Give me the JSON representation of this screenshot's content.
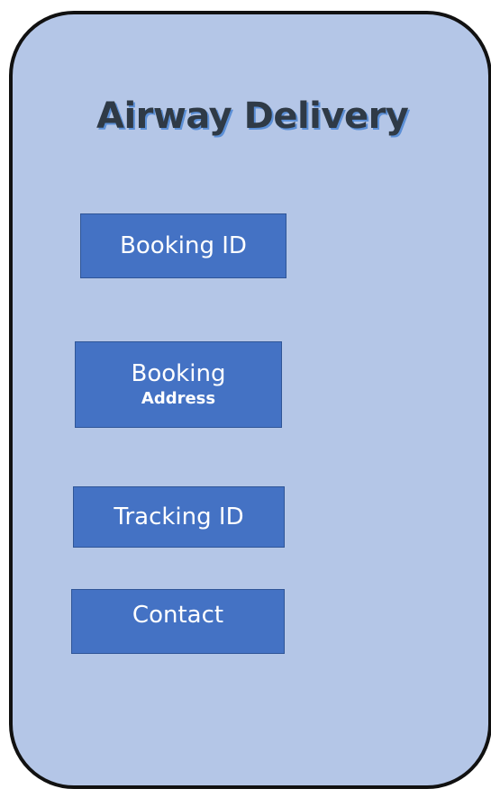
{
  "app": {
    "title": "Airway Delivery"
  },
  "menu": {
    "booking_id": {
      "label": "Booking ID"
    },
    "booking_address": {
      "label": "Booking",
      "sublabel": "Address"
    },
    "tracking_id": {
      "label": "Tracking ID"
    },
    "contact": {
      "label": "Contact"
    }
  },
  "colors": {
    "background": "#b4c6e7",
    "button": "#4472c4",
    "title": "#2f3a46",
    "title_shadow": "#5b8fd6",
    "frame_border": "#111111"
  }
}
